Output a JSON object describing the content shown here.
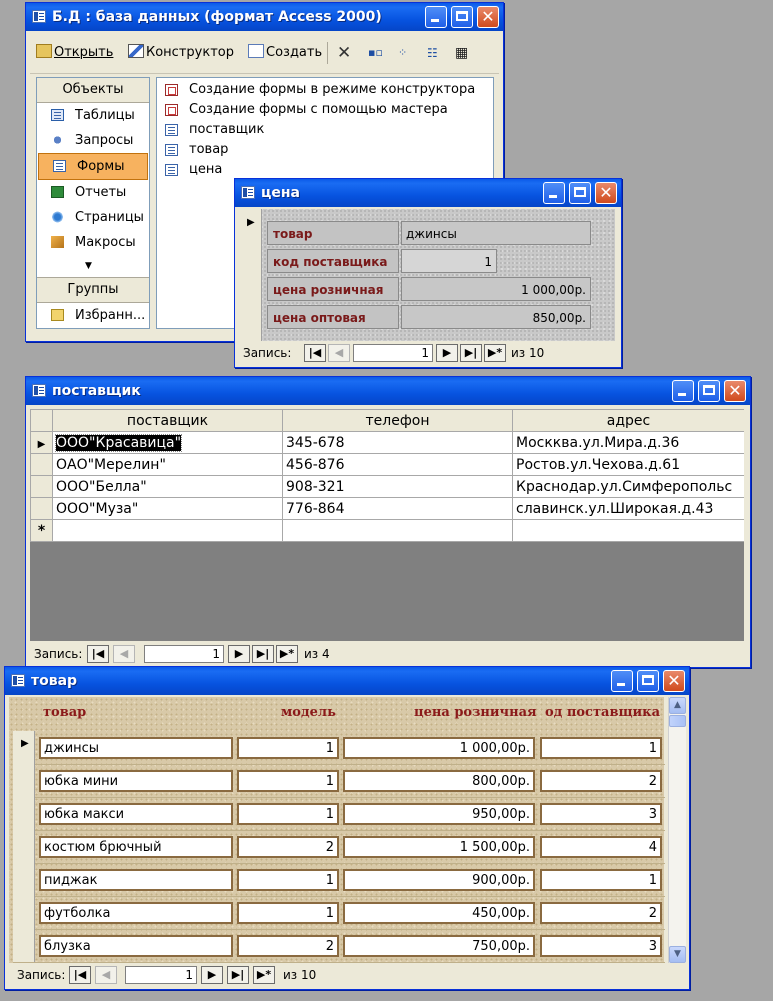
{
  "main_window": {
    "title": "Б.Д : база данных (формат Access 2000)",
    "toolbar": {
      "open": "Открыть",
      "design": "Конструктор",
      "create": "Создать"
    },
    "objects_header": "Объекты",
    "objects": [
      "Таблицы",
      "Запросы",
      "Формы",
      "Отчеты",
      "Страницы",
      "Макросы"
    ],
    "selected_object": "Формы",
    "groups_header": "Группы",
    "favorites": "Избранн...",
    "items": [
      "Создание формы в режиме конструктора",
      "Создание формы с помощью мастера",
      "поставщик",
      "товар",
      "цена"
    ]
  },
  "cena_window": {
    "title": "цена",
    "fields": [
      {
        "label": "товар",
        "value": "джинсы"
      },
      {
        "label": "код поставщика",
        "value": "1"
      },
      {
        "label": "цена розничная",
        "value": "1 000,00р."
      },
      {
        "label": "цена оптовая",
        "value": "850,00р."
      }
    ],
    "nav": {
      "label": "Запись:",
      "current": "1",
      "of_text": "из  10"
    }
  },
  "supplier_window": {
    "title": "поставщик",
    "columns": [
      "поставщик",
      "телефон",
      "адрес"
    ],
    "rows": [
      [
        "ООО\"Красавица\"",
        "345-678",
        "Москква.ул.Мира.д.36"
      ],
      [
        "ОАО\"Мерелин\"",
        "456-876",
        "Ростов.ул.Чехова.д.61"
      ],
      [
        "ООО\"Белла\"",
        "908-321",
        "Краснодар.ул.Симферопольс"
      ],
      [
        "ООО\"Муза\"",
        "776-864",
        "славинск.ул.Широкая.д.43"
      ]
    ],
    "new_row_marker": "*",
    "nav": {
      "label": "Запись:",
      "current": "1",
      "of_text": "из  4"
    }
  },
  "goods_window": {
    "title": "товар",
    "headers": [
      "товар",
      "модель",
      "цена розничная",
      "од поставщика"
    ],
    "rows": [
      [
        "джинсы",
        "1",
        "1 000,00р.",
        "1"
      ],
      [
        "юбка мини",
        "1",
        "800,00р.",
        "2"
      ],
      [
        "юбка макси",
        "1",
        "950,00р.",
        "3"
      ],
      [
        "костюм брючный",
        "2",
        "1 500,00р.",
        "4"
      ],
      [
        "пиджак",
        "1",
        "900,00р.",
        "1"
      ],
      [
        "футболка",
        "1",
        "450,00р.",
        "2"
      ],
      [
        "блузка",
        "2",
        "750,00р.",
        "3"
      ]
    ],
    "nav": {
      "label": "Запись:",
      "current": "1",
      "of_text": "из  10"
    }
  },
  "colors": {
    "title_bar": "#0753e0",
    "selected_object": "#f7b25f",
    "form_label": "#7a1a1a",
    "goods_header": "#8b1a1a"
  }
}
